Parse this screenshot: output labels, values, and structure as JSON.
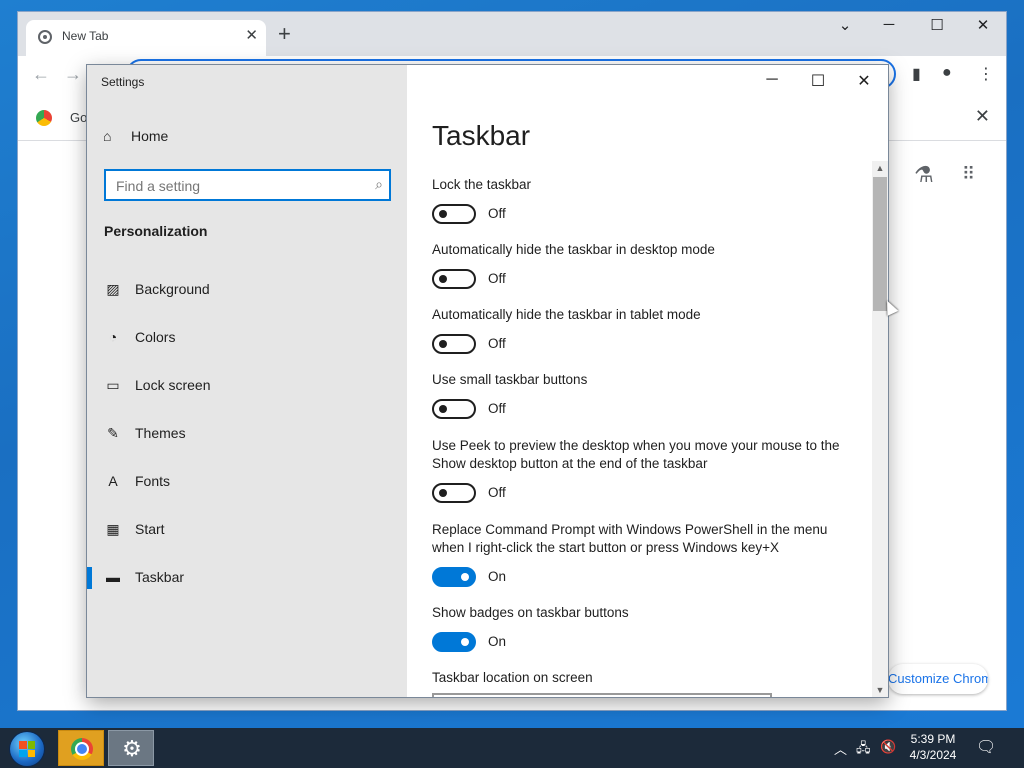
{
  "browser": {
    "tab_title": "New Tab",
    "tab_close": "✕",
    "new_tab": "+",
    "bookmark_label": "Go",
    "customize_label": "Customize Chrome"
  },
  "settings": {
    "app_title": "Settings",
    "home_label": "Home",
    "search_placeholder": "Find a setting",
    "section_label": "Personalization",
    "nav": [
      {
        "label": "Background",
        "icon": "image-icon"
      },
      {
        "label": "Colors",
        "icon": "palette-icon"
      },
      {
        "label": "Lock screen",
        "icon": "lock-screen-icon"
      },
      {
        "label": "Themes",
        "icon": "themes-icon"
      },
      {
        "label": "Fonts",
        "icon": "fonts-icon"
      },
      {
        "label": "Start",
        "icon": "start-icon"
      },
      {
        "label": "Taskbar",
        "icon": "taskbar-icon",
        "active": true
      }
    ],
    "page_title": "Taskbar",
    "options": [
      {
        "label": "Lock the taskbar",
        "state": "Off"
      },
      {
        "label": "Automatically hide the taskbar in desktop mode",
        "state": "Off"
      },
      {
        "label": "Automatically hide the taskbar in tablet mode",
        "state": "Off"
      },
      {
        "label": "Use small taskbar buttons",
        "state": "Off"
      },
      {
        "label": "Use Peek to preview the desktop when you move your mouse to the Show desktop button at the end of the taskbar",
        "state": "Off"
      },
      {
        "label": "Replace Command Prompt with Windows PowerShell in the menu when I right-click the start button or press Windows key+X",
        "state": "On"
      },
      {
        "label": "Show badges on taskbar buttons",
        "state": "On"
      }
    ],
    "location_label": "Taskbar location on screen"
  },
  "taskbar": {
    "time": "5:39 PM",
    "date": "4/3/2024"
  },
  "colors": {
    "accent": "#0078d7",
    "sidebar_bg": "#e6e6e6",
    "taskbar_bg": "#1c2a3a"
  }
}
